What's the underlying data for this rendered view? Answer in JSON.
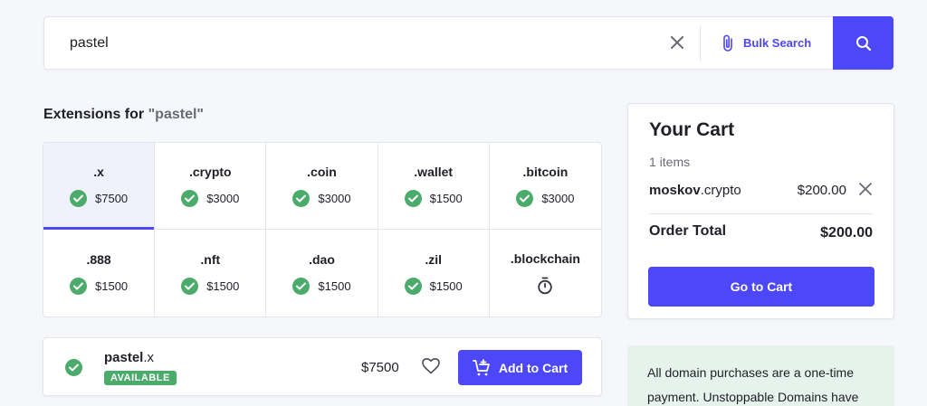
{
  "search": {
    "value": "pastel",
    "bulk_label": "Bulk Search"
  },
  "extensions": {
    "heading_prefix": "Extensions for ",
    "heading_query": "\"pastel\"",
    "items": [
      {
        "name": ".x",
        "price": "$7500",
        "status": "available"
      },
      {
        "name": ".crypto",
        "price": "$3000",
        "status": "available"
      },
      {
        "name": ".coin",
        "price": "$3000",
        "status": "available"
      },
      {
        "name": ".wallet",
        "price": "$1500",
        "status": "available"
      },
      {
        "name": ".bitcoin",
        "price": "$3000",
        "status": "available"
      },
      {
        "name": ".888",
        "price": "$1500",
        "status": "available"
      },
      {
        "name": ".nft",
        "price": "$1500",
        "status": "available"
      },
      {
        "name": ".dao",
        "price": "$1500",
        "status": "available"
      },
      {
        "name": ".zil",
        "price": "$1500",
        "status": "available"
      },
      {
        "name": ".blockchain",
        "price": "",
        "status": "pending"
      }
    ]
  },
  "result": {
    "name": "pastel",
    "ext": ".x",
    "badge": "AVAILABLE",
    "price": "$7500",
    "add_label": "Add to Cart"
  },
  "cart": {
    "title": "Your Cart",
    "count": "1 items",
    "item_name": "moskov",
    "item_ext": ".crypto",
    "item_price": "$200.00",
    "total_label": "Order Total",
    "total_value": "$200.00",
    "go_label": "Go to Cart"
  },
  "info": {
    "text": "All domain purchases are a one-time payment. Unstoppable Domains have"
  },
  "colors": {
    "accent": "#4c47f7",
    "success": "#4bab6b",
    "info_bg": "#e6f2ec"
  }
}
